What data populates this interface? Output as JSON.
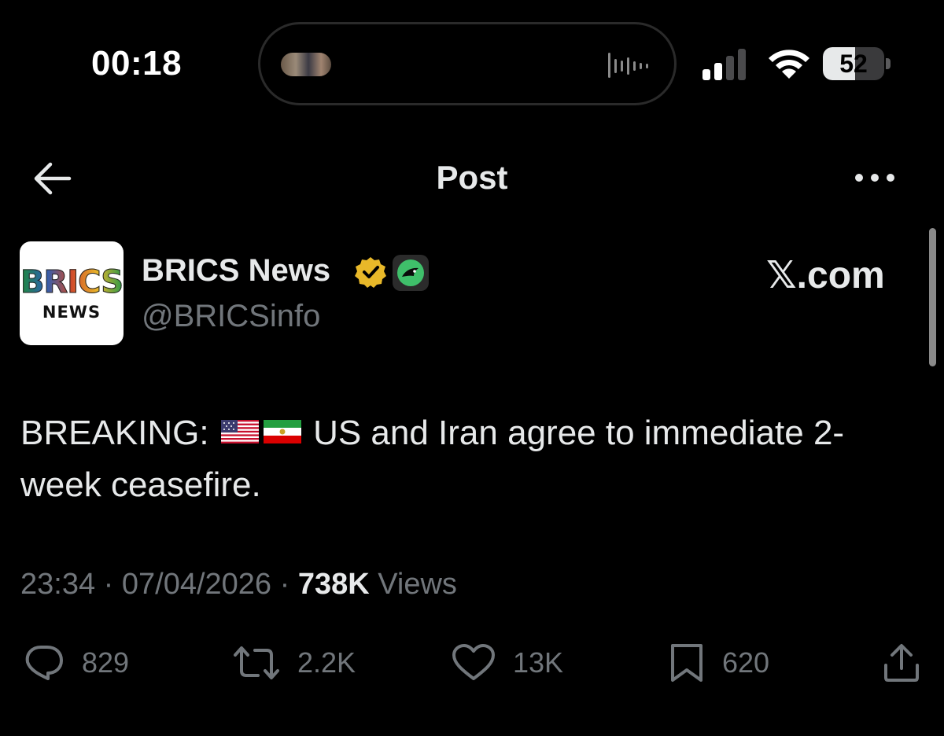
{
  "status_bar": {
    "time": "00:18",
    "battery": "52",
    "battery_fraction": 0.52
  },
  "header": {
    "title": "Post"
  },
  "author": {
    "avatar_line1": "BRICS",
    "avatar_line2": "NEWS",
    "name": "BRICS News",
    "handle": "@BRICSinfo",
    "verified": "gold-verified-badge",
    "source_label": "𝕏.com"
  },
  "tweet": {
    "text_before": "BREAKING: ",
    "flags": [
      "us-flag",
      "iran-flag"
    ],
    "text_after": " US and Iran agree to immediate 2-week ceasefire."
  },
  "meta": {
    "time": "23:34",
    "date": "07/04/2026",
    "views_count": "738K",
    "views_label": "Views",
    "separator": "·"
  },
  "actions": {
    "replies": "829",
    "reposts": "2.2K",
    "likes": "13K",
    "bookmarks": "620"
  },
  "colors": {
    "background": "#000000",
    "text": "#e7e9ea",
    "muted": "#71767b",
    "verified_gold": "#e8b829"
  }
}
